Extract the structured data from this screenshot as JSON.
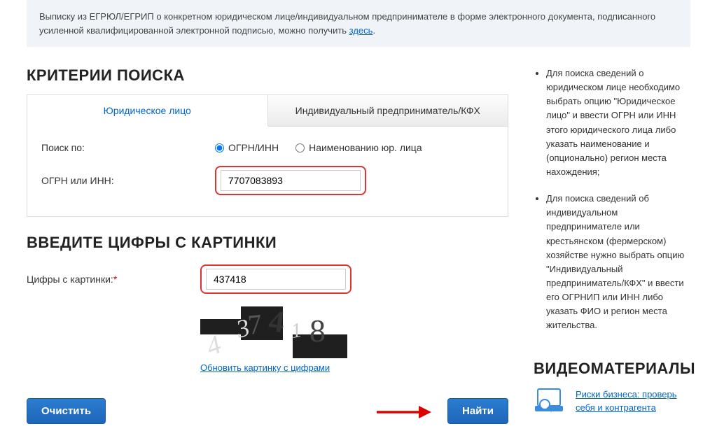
{
  "info": {
    "text_start": "Выписку из ЕГРЮЛ/ЕГРИП о конкретном юридическом лице/индивидуальном предпринимателе в форме электронного документа, подписанного усиленной квалифицированной электронной подписью, можно получить ",
    "link": "здесь",
    "text_end": "."
  },
  "search": {
    "heading": "КРИТЕРИИ ПОИСКА",
    "tabs": {
      "legal": "Юридическое лицо",
      "individual": "Индивидуальный предприниматель/КФХ"
    },
    "label_search_by": "Поиск по:",
    "radio_ogrn": "ОГРН/ИНН",
    "radio_name": "Наименованию юр. лица",
    "label_ogrn": "ОГРН или ИНН:",
    "ogrn_value": "7707083893"
  },
  "captcha": {
    "heading": "ВВЕДИТЕ ЦИФРЫ С КАРТИНКИ",
    "label": "Цифры с картинки:",
    "value": "437418",
    "refresh": "Обновить картинку с цифрами",
    "digits": {
      "d1": "4",
      "d2": "3",
      "d3": "7",
      "d4": "4",
      "d5": "1",
      "d6": "8"
    }
  },
  "buttons": {
    "clear": "Очистить",
    "find": "Найти"
  },
  "help": {
    "item1": "Для поиска сведений о юридическом лице необходимо выбрать опцию \"Юридическое лицо\" и ввести ОГРН или ИНН этого юридического лица либо указать наименование и (опционально) регион места нахождения;",
    "item2": "Для поиска сведений об индивидуальном предпринимателе или крестьянском (фермерском) хозяйстве нужно выбрать опцию \"Индивидуальный предприниматель/КФХ\" и ввести его ОГРНИП или ИНН либо указать ФИО и регион места жительства."
  },
  "video": {
    "heading": "ВИДЕОМАТЕРИАЛЫ",
    "link": "Риски бизнеса: проверь себя и контрагента"
  }
}
